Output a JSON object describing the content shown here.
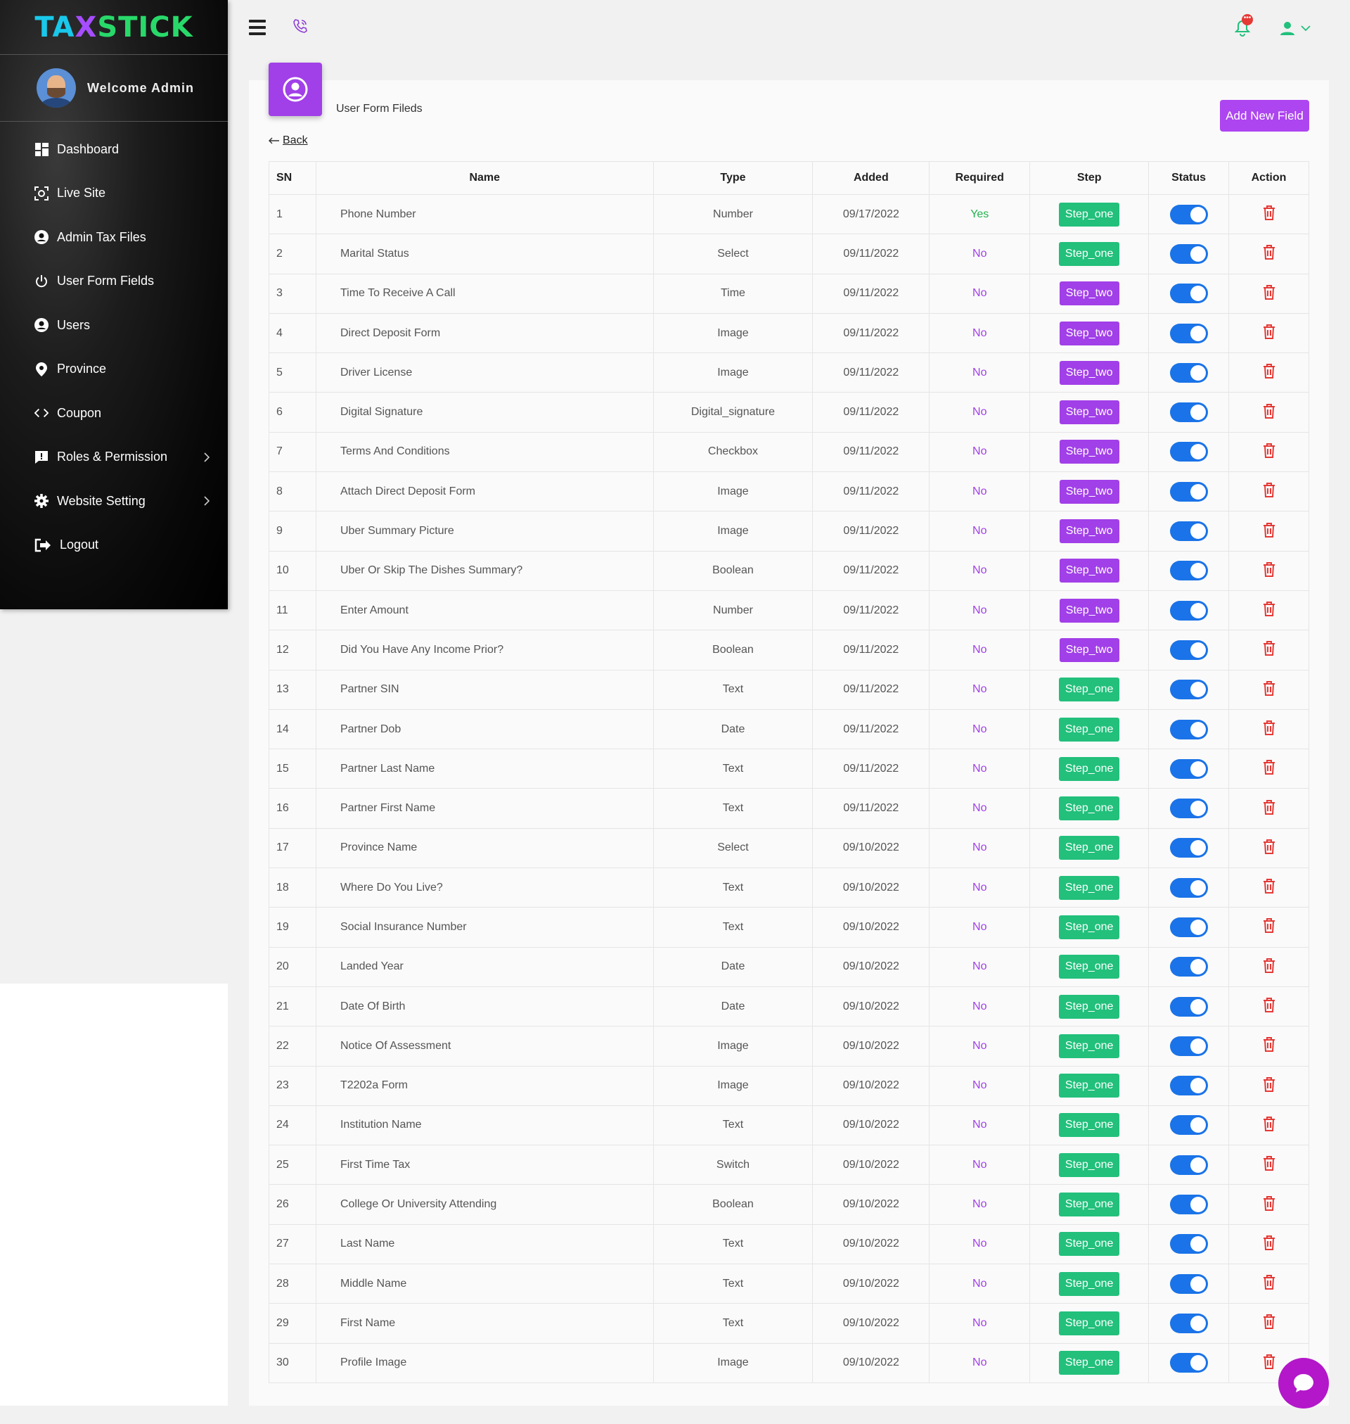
{
  "brand": {
    "part1": "TA",
    "part2": "X",
    "part3": "STICK",
    "colors": {
      "part1": "#19c8ea",
      "part2": "#a64dff",
      "part3": "#28d96a"
    }
  },
  "sidebar": {
    "welcome": "Welcome Admin",
    "items": [
      {
        "label": "Dashboard",
        "icon": "dashboard-icon"
      },
      {
        "label": "Live Site",
        "icon": "live-site-icon"
      },
      {
        "label": "Admin Tax Files",
        "icon": "user-circle-icon"
      },
      {
        "label": "User Form Fields",
        "icon": "power-icon"
      },
      {
        "label": "Users",
        "icon": "user-circle-icon"
      },
      {
        "label": "Province",
        "icon": "map-pin-icon"
      },
      {
        "label": "Coupon",
        "icon": "code-icon"
      },
      {
        "label": "Roles & Permission",
        "icon": "alert-comment-icon",
        "submenu": true
      },
      {
        "label": "Website Setting",
        "icon": "gear-icon",
        "submenu": true
      },
      {
        "label": "Logout",
        "icon": "logout-icon"
      }
    ]
  },
  "topbar": {
    "notification_badge": "•••"
  },
  "page": {
    "title": "User Form Fileds",
    "back_label": "Back",
    "add_button": "Add New Field"
  },
  "table": {
    "headers": {
      "sn": "SN",
      "name": "Name",
      "type": "Type",
      "added": "Added",
      "required": "Required",
      "step": "Step",
      "status": "Status",
      "action": "Action"
    },
    "rows": [
      {
        "sn": "1",
        "name": "Phone Number",
        "type": "Number",
        "added": "09/17/2022",
        "required": "Yes",
        "step": "Step_one",
        "status": true
      },
      {
        "sn": "2",
        "name": "Marital Status",
        "type": "Select",
        "added": "09/11/2022",
        "required": "No",
        "step": "Step_one",
        "status": true
      },
      {
        "sn": "3",
        "name": "Time To Receive A Call",
        "type": "Time",
        "added": "09/11/2022",
        "required": "No",
        "step": "Step_two",
        "status": true
      },
      {
        "sn": "4",
        "name": "Direct Deposit Form",
        "type": "Image",
        "added": "09/11/2022",
        "required": "No",
        "step": "Step_two",
        "status": true
      },
      {
        "sn": "5",
        "name": "Driver License",
        "type": "Image",
        "added": "09/11/2022",
        "required": "No",
        "step": "Step_two",
        "status": true
      },
      {
        "sn": "6",
        "name": "Digital Signature",
        "type": "Digital_signature",
        "added": "09/11/2022",
        "required": "No",
        "step": "Step_two",
        "status": true
      },
      {
        "sn": "7",
        "name": "Terms And Conditions",
        "type": "Checkbox",
        "added": "09/11/2022",
        "required": "No",
        "step": "Step_two",
        "status": true
      },
      {
        "sn": "8",
        "name": "Attach Direct Deposit Form",
        "type": "Image",
        "added": "09/11/2022",
        "required": "No",
        "step": "Step_two",
        "status": true
      },
      {
        "sn": "9",
        "name": "Uber Summary Picture",
        "type": "Image",
        "added": "09/11/2022",
        "required": "No",
        "step": "Step_two",
        "status": true
      },
      {
        "sn": "10",
        "name": "Uber Or Skip The Dishes Summary?",
        "type": "Boolean",
        "added": "09/11/2022",
        "required": "No",
        "step": "Step_two",
        "status": true
      },
      {
        "sn": "11",
        "name": "Enter Amount",
        "type": "Number",
        "added": "09/11/2022",
        "required": "No",
        "step": "Step_two",
        "status": true
      },
      {
        "sn": "12",
        "name": "Did You Have Any Income Prior?",
        "type": "Boolean",
        "added": "09/11/2022",
        "required": "No",
        "step": "Step_two",
        "status": true
      },
      {
        "sn": "13",
        "name": "Partner SIN",
        "type": "Text",
        "added": "09/11/2022",
        "required": "No",
        "step": "Step_one",
        "status": true
      },
      {
        "sn": "14",
        "name": "Partner Dob",
        "type": "Date",
        "added": "09/11/2022",
        "required": "No",
        "step": "Step_one",
        "status": true
      },
      {
        "sn": "15",
        "name": "Partner Last Name",
        "type": "Text",
        "added": "09/11/2022",
        "required": "No",
        "step": "Step_one",
        "status": true
      },
      {
        "sn": "16",
        "name": "Partner First Name",
        "type": "Text",
        "added": "09/11/2022",
        "required": "No",
        "step": "Step_one",
        "status": true
      },
      {
        "sn": "17",
        "name": "Province Name",
        "type": "Select",
        "added": "09/10/2022",
        "required": "No",
        "step": "Step_one",
        "status": true
      },
      {
        "sn": "18",
        "name": "Where Do You Live?",
        "type": "Text",
        "added": "09/10/2022",
        "required": "No",
        "step": "Step_one",
        "status": true
      },
      {
        "sn": "19",
        "name": "Social Insurance Number",
        "type": "Text",
        "added": "09/10/2022",
        "required": "No",
        "step": "Step_one",
        "status": true
      },
      {
        "sn": "20",
        "name": "Landed Year",
        "type": "Date",
        "added": "09/10/2022",
        "required": "No",
        "step": "Step_one",
        "status": true
      },
      {
        "sn": "21",
        "name": "Date Of Birth",
        "type": "Date",
        "added": "09/10/2022",
        "required": "No",
        "step": "Step_one",
        "status": true
      },
      {
        "sn": "22",
        "name": "Notice Of Assessment",
        "type": "Image",
        "added": "09/10/2022",
        "required": "No",
        "step": "Step_one",
        "status": true
      },
      {
        "sn": "23",
        "name": "T2202a Form",
        "type": "Image",
        "added": "09/10/2022",
        "required": "No",
        "step": "Step_one",
        "status": true
      },
      {
        "sn": "24",
        "name": "Institution Name",
        "type": "Text",
        "added": "09/10/2022",
        "required": "No",
        "step": "Step_one",
        "status": true
      },
      {
        "sn": "25",
        "name": "First Time Tax",
        "type": "Switch",
        "added": "09/10/2022",
        "required": "No",
        "step": "Step_one",
        "status": true
      },
      {
        "sn": "26",
        "name": "College Or University Attending",
        "type": "Boolean",
        "added": "09/10/2022",
        "required": "No",
        "step": "Step_one",
        "status": true
      },
      {
        "sn": "27",
        "name": "Last Name",
        "type": "Text",
        "added": "09/10/2022",
        "required": "No",
        "step": "Step_one",
        "status": true
      },
      {
        "sn": "28",
        "name": "Middle Name",
        "type": "Text",
        "added": "09/10/2022",
        "required": "No",
        "step": "Step_one",
        "status": true
      },
      {
        "sn": "29",
        "name": "First Name",
        "type": "Text",
        "added": "09/10/2022",
        "required": "No",
        "step": "Step_one",
        "status": true
      },
      {
        "sn": "30",
        "name": "Profile Image",
        "type": "Image",
        "added": "09/10/2022",
        "required": "No",
        "step": "Step_one",
        "status": true
      }
    ]
  },
  "colors": {
    "accent_purple": "#a13fe8",
    "step_one_green": "#22c07b",
    "required_yes": "#21b24e",
    "toggle_blue": "#1a73e8",
    "delete_red": "#e53935"
  }
}
